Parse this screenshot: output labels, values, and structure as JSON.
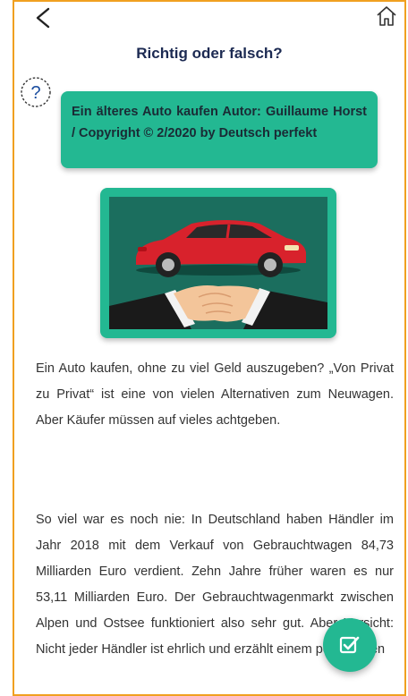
{
  "header": {
    "title": "Richtig oder falsch?"
  },
  "info_card": {
    "text": "Ein älteres Auto kaufen Autor: Guillaume Horst / Copyright © 2/2020 by Deutsch perfekt"
  },
  "article": {
    "paragraph_1": "Ein Auto kaufen, ohne zu viel Geld auszugeben? „Von Privat zu Privat“ ist eine von vielen Alternativen zum Neuwagen. Aber Käufer müssen auf vieles achtgeben.",
    "paragraph_2": "So viel war es noch nie: In Deutschland haben Händler im Jahr 2018 mit dem Verkauf von Gebrauchtwagen 84,73 Milliarden Euro verdient. Zehn Jahre früher waren es nur 53,11 Milliarden Euro. Der Gebrauchtwagenmarkt zwischen Alpen und Ostsee funktioniert also sehr gut. Aber Vorsicht: Nicht jeder Händler ist ehrlich und erzählt einem potenziellen"
  },
  "icons": {
    "back": "chevron-left-icon",
    "home": "home-icon",
    "help": "question-icon",
    "fab": "check-edit-icon"
  },
  "colors": {
    "accent": "#23b892",
    "title": "#1c2a52",
    "frame_border": "#f0a020",
    "image_bg": "#1b6e5e",
    "car": "#d8222c"
  }
}
